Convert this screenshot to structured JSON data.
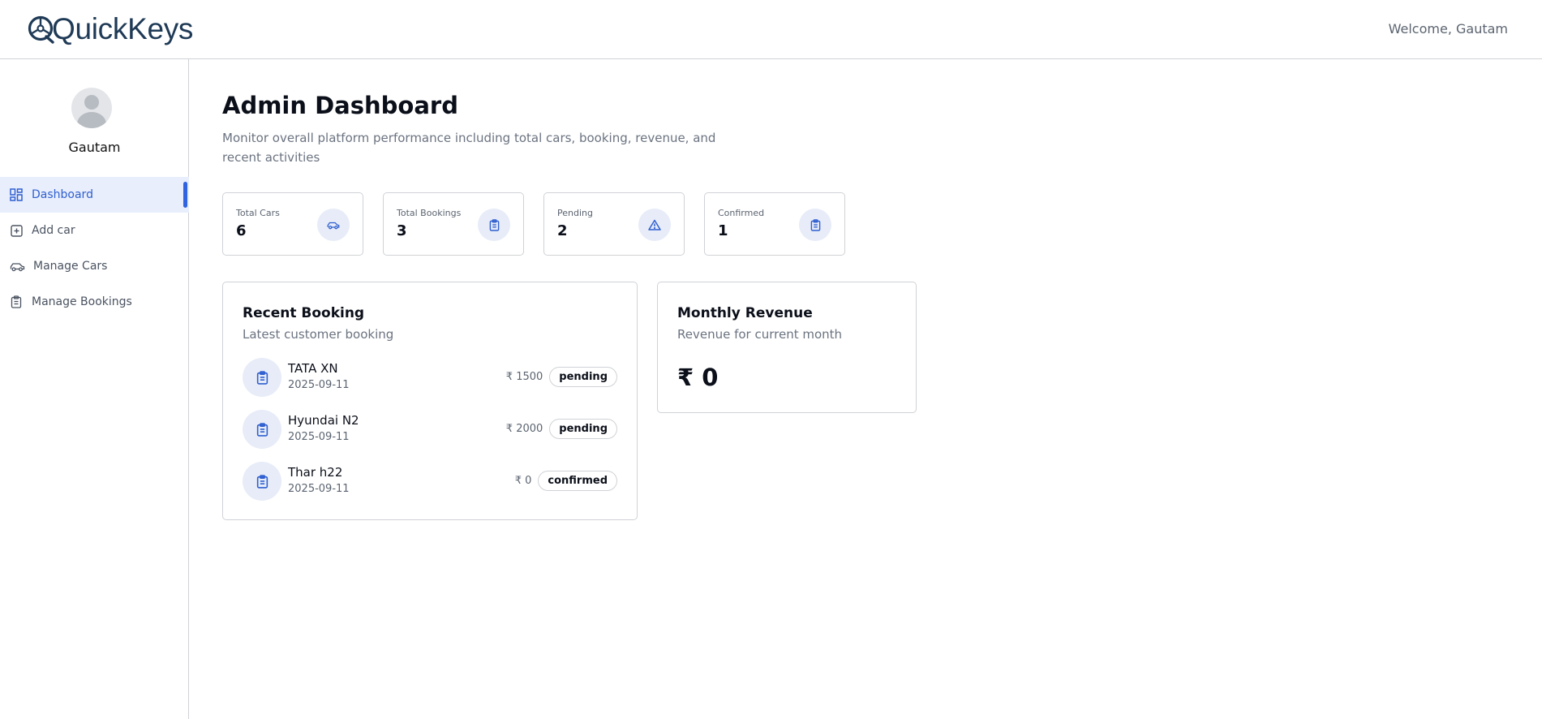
{
  "header": {
    "logo_text": "QuickKeys",
    "welcome": "Welcome, Gautam"
  },
  "sidebar": {
    "profile_name": "Gautam",
    "items": [
      {
        "label": "Dashboard",
        "icon": "dashboard-icon",
        "active": true
      },
      {
        "label": "Add car",
        "icon": "add-square-icon",
        "active": false
      },
      {
        "label": "Manage Cars",
        "icon": "car-icon",
        "active": false
      },
      {
        "label": "Manage Bookings",
        "icon": "clipboard-icon",
        "active": false
      }
    ]
  },
  "main": {
    "title": "Admin Dashboard",
    "subtitle": "Monitor overall platform performance including total cars, booking, revenue, and recent activities",
    "stats": [
      {
        "label": "Total Cars",
        "value": "6",
        "icon": "car-icon"
      },
      {
        "label": "Total Bookings",
        "value": "3",
        "icon": "clipboard-icon"
      },
      {
        "label": "Pending",
        "value": "2",
        "icon": "warning-icon"
      },
      {
        "label": "Confirmed",
        "value": "1",
        "icon": "clipboard-icon"
      }
    ],
    "recent_booking": {
      "title": "Recent Booking",
      "subtitle": "Latest customer booking",
      "rows": [
        {
          "car": "TATA XN",
          "date": "2025-09-11",
          "price": "₹ 1500",
          "status": "pending"
        },
        {
          "car": "Hyundai N2",
          "date": "2025-09-11",
          "price": "₹ 2000",
          "status": "pending"
        },
        {
          "car": "Thar h22",
          "date": "2025-09-11",
          "price": "₹ 0",
          "status": "confirmed"
        }
      ]
    },
    "monthly_revenue": {
      "title": "Monthly Revenue",
      "subtitle": "Revenue for current month",
      "value": "₹ 0"
    }
  },
  "colors": {
    "accent": "#2f63e0",
    "active_bg": "#e8eefc",
    "icon_bg": "#e7ecf8",
    "logo": "#1f3a56"
  }
}
